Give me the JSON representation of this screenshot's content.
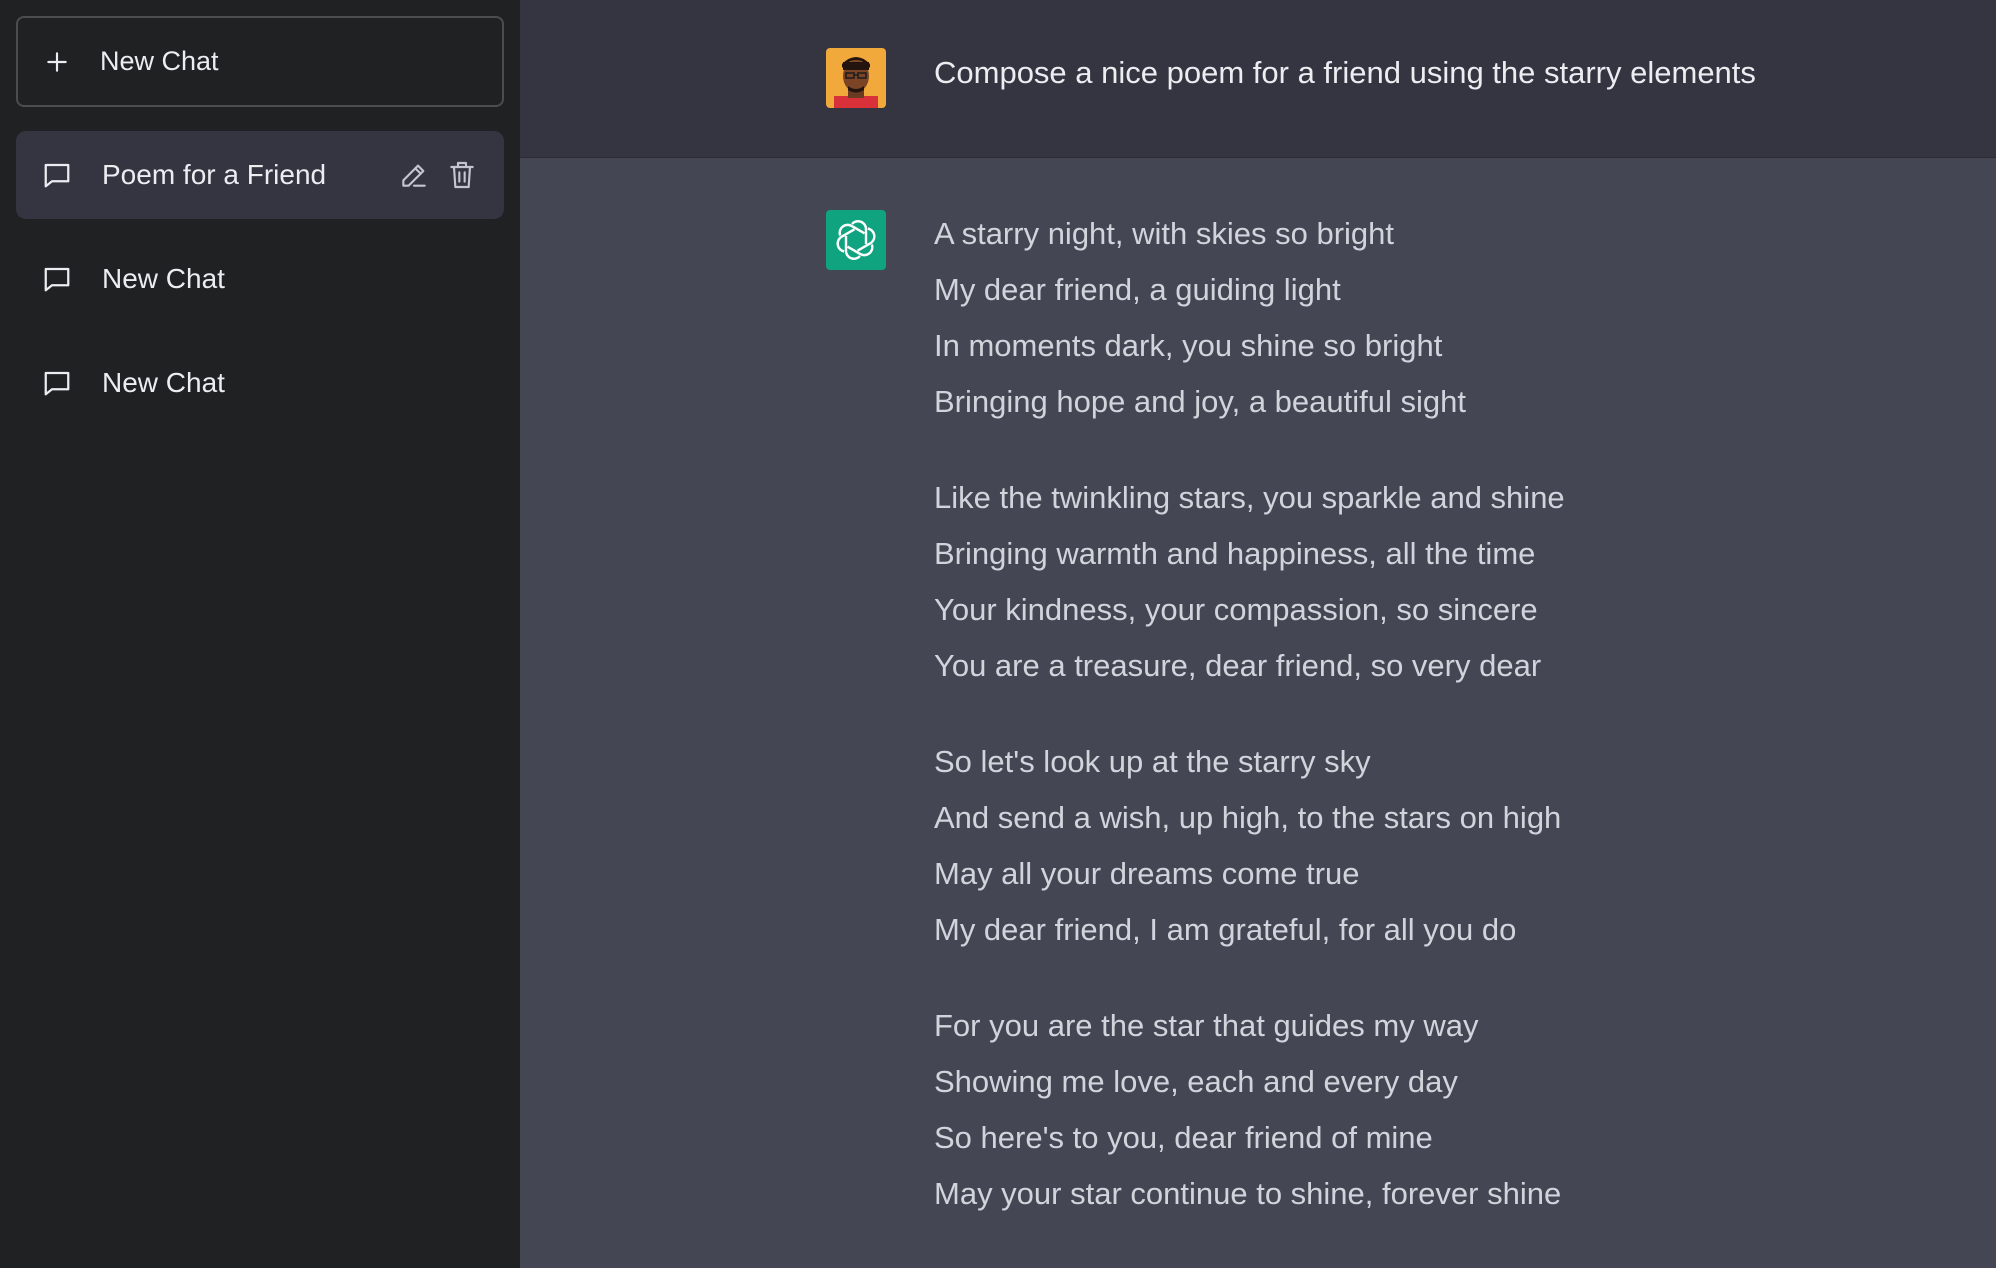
{
  "sidebar": {
    "new_chat_label": "New Chat",
    "items": [
      {
        "label": "Poem for a Friend"
      },
      {
        "label": "New Chat"
      },
      {
        "label": "New Chat"
      }
    ]
  },
  "conversation": {
    "user_message": "Compose a nice poem for a friend using the starry elements",
    "response": {
      "stanzas": [
        [
          "A starry night, with skies so bright",
          "My dear friend, a guiding light",
          "In moments dark, you shine so bright",
          "Bringing hope and joy, a beautiful sight"
        ],
        [
          "Like the twinkling stars, you sparkle and shine",
          "Bringing warmth and happiness, all the time",
          "Your kindness, your compassion, so sincere",
          "You are a treasure, dear friend, so very dear"
        ],
        [
          "So let's look up at the starry sky",
          "And send a wish, up high, to the stars on high",
          "May all your dreams come true",
          "My dear friend, I am grateful, for all you do"
        ],
        [
          "For you are the star that guides my way",
          "Showing me love, each and every day",
          "So here's to you, dear friend of mine",
          "May your star continue to shine, forever shine"
        ]
      ]
    }
  },
  "colors": {
    "sidebar_bg": "#202123",
    "active_item_bg": "#343541",
    "user_row_bg": "#343541",
    "bot_row_bg": "#444654",
    "bot_avatar_bg": "#10a37f",
    "text": "#ececf1"
  },
  "icons": {
    "new_chat": "plus-icon",
    "chat_item": "message-icon",
    "edit": "pencil-icon",
    "delete": "trash-icon",
    "bot": "openai-logo-icon"
  }
}
